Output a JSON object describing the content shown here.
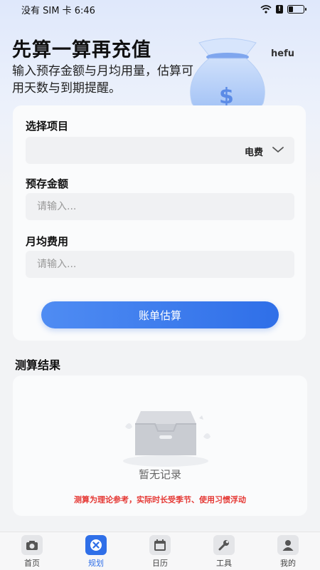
{
  "status_bar": {
    "carrier_time": "没有 SIM 卡 6:46",
    "battery_level": 0.3
  },
  "header": {
    "title": "先算一算再充值",
    "subtitle": "输入预存金额与月均用量，估算可用天数与到期提醒。",
    "brand": "hefu",
    "illustration": "money-bag"
  },
  "form": {
    "project_label": "选择项目",
    "project_value": "电费",
    "deposit_label": "预存金额",
    "deposit_placeholder": "请输入...",
    "deposit_value": "",
    "monthly_label": "月均费用",
    "monthly_placeholder": "请输入...",
    "monthly_value": "",
    "submit_label": "账单估算"
  },
  "result": {
    "section_title": "测算结果",
    "empty_text": "暂无记录",
    "disclaimer": "测算为理论参考，实际时长受季节、使用习惯浮动"
  },
  "tabs": [
    {
      "label": "首页",
      "icon": "home-icon",
      "active": false
    },
    {
      "label": "规划",
      "icon": "plan-icon",
      "active": true
    },
    {
      "label": "日历",
      "icon": "calendar-icon",
      "active": false
    },
    {
      "label": "工具",
      "icon": "wrench-icon",
      "active": false
    },
    {
      "label": "我的",
      "icon": "user-icon",
      "active": false
    }
  ],
  "colors": {
    "accent": "#2f6fe8",
    "warning": "#e53935"
  }
}
